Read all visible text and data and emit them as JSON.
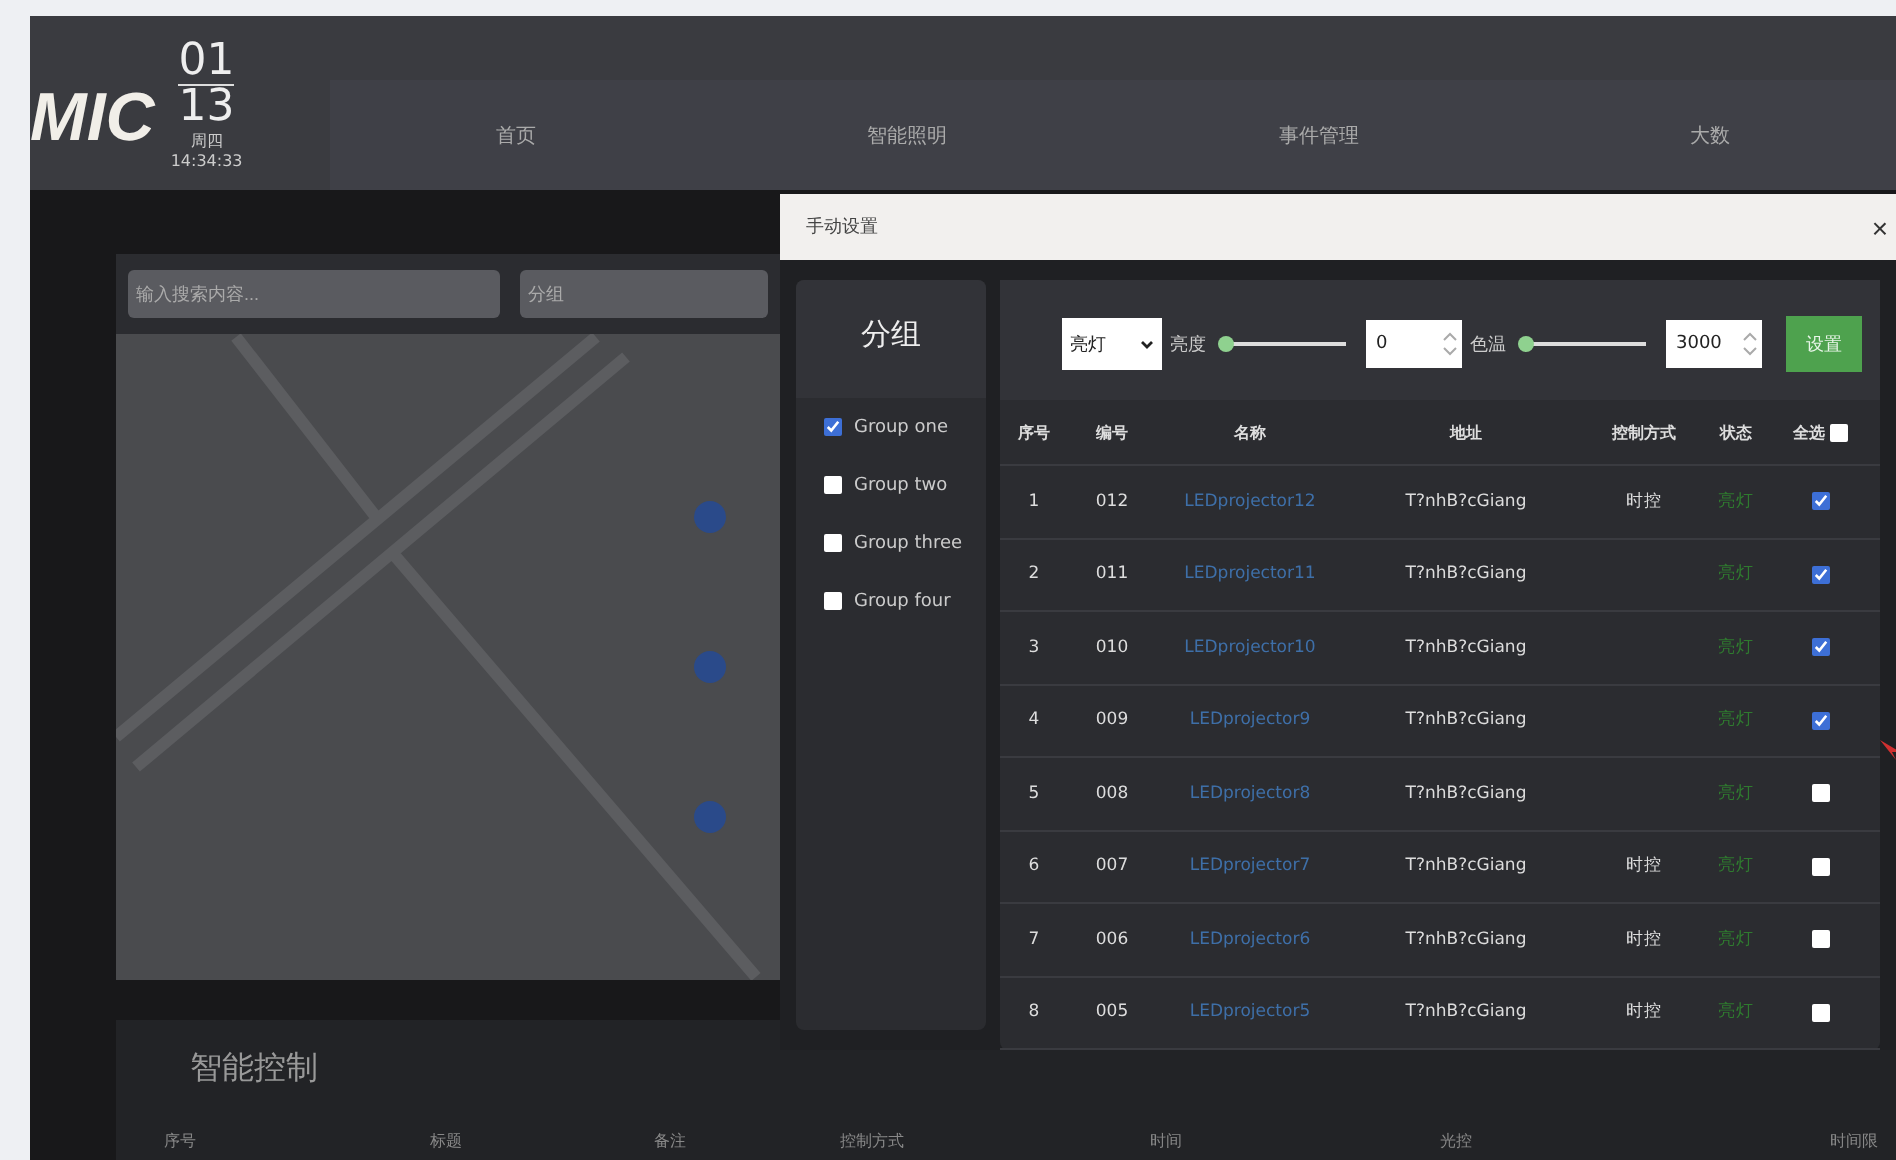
{
  "header": {
    "logo": "MIC",
    "month": "01",
    "day": "13",
    "weekday": "周四",
    "time": "14:34:33"
  },
  "nav": [
    "首页",
    "智能照明",
    "事件管理",
    "大数"
  ],
  "map_panel": {
    "search": {
      "placeholder": "输入搜索内容..."
    },
    "group_select": {
      "value": "分组"
    }
  },
  "control_card": {
    "title": "智能控制",
    "columns": [
      "序号",
      "标题",
      "备注",
      "控制方式",
      "时间",
      "光控",
      "时间限"
    ]
  },
  "modal": {
    "title": "手动设置",
    "close": "×",
    "groups": {
      "title": "分组",
      "items": [
        {
          "label": "Group one",
          "checked": true
        },
        {
          "label": "Group two",
          "checked": false
        },
        {
          "label": "Group three",
          "checked": false
        },
        {
          "label": "Group four",
          "checked": false
        }
      ]
    },
    "toolbar": {
      "mode": "亮灯",
      "brightness": {
        "label": "亮度",
        "level": 0,
        "value": "0"
      },
      "color_temp": {
        "label": "色温",
        "level": 0,
        "value": "3000"
      },
      "button": "设置"
    },
    "table": {
      "columns": [
        "序号",
        "编号",
        "名称",
        "地址",
        "控制方式",
        "状态"
      ],
      "select_all": {
        "label": "全选",
        "checked": false
      },
      "rows": [
        {
          "index": "1",
          "code": "012",
          "name": "LEDprojector12",
          "address": "T?nhB?cGiang",
          "control": "时控",
          "status": "亮灯",
          "checked": true
        },
        {
          "index": "2",
          "code": "011",
          "name": "LEDprojector11",
          "address": "T?nhB?cGiang",
          "status": "亮灯",
          "checked": true
        },
        {
          "index": "3",
          "code": "010",
          "name": "LEDprojector10",
          "address": "T?nhB?cGiang",
          "status": "亮灯",
          "checked": true
        },
        {
          "index": "4",
          "code": "009",
          "name": "LEDprojector9",
          "address": "T?nhB?cGiang",
          "status": "亮灯",
          "checked": true
        },
        {
          "index": "5",
          "code": "008",
          "name": "LEDprojector8",
          "address": "T?nhB?cGiang",
          "status": "亮灯",
          "checked": false
        },
        {
          "index": "6",
          "code": "007",
          "name": "LEDprojector7",
          "address": "T?nhB?cGiang",
          "control": "时控",
          "status": "亮灯",
          "checked": false
        },
        {
          "index": "7",
          "code": "006",
          "name": "LEDprojector6",
          "address": "T?nhB?cGiang",
          "control": "时控",
          "status": "亮灯",
          "checked": false
        },
        {
          "index": "8",
          "code": "005",
          "name": "LEDprojector5",
          "address": "T?nhB?cGiang",
          "control": "时控",
          "status": "亮灯",
          "checked": false
        }
      ]
    }
  }
}
